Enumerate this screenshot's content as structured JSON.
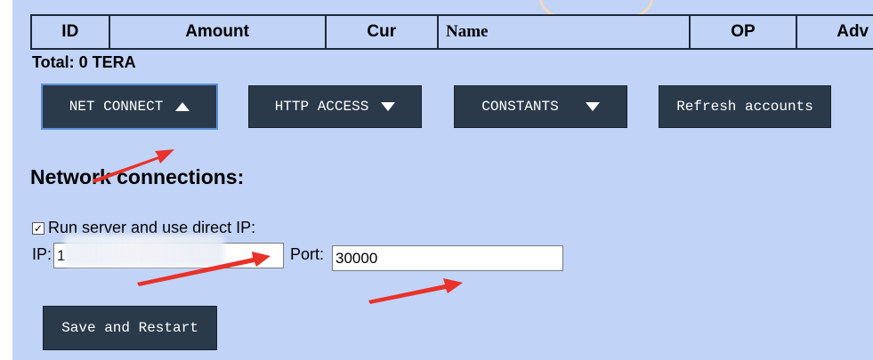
{
  "table_header": {
    "columns": [
      "ID",
      "Amount",
      "Cur",
      "Name",
      "OP",
      "Adv"
    ]
  },
  "total": "Total: 0 TERA",
  "buttons": {
    "net_connect": "NET CONNECT",
    "http_access": "HTTP ACCESS",
    "constants": "CONSTANTS",
    "refresh_accounts": "Refresh accounts",
    "save_restart": "Save and Restart"
  },
  "section_title": "Network connections:",
  "run_server": {
    "label": "Run server and use direct IP:",
    "checked": true
  },
  "ip": {
    "label": "IP:",
    "value": "1"
  },
  "port": {
    "label": "Port:",
    "value": "30000"
  },
  "colors": {
    "panel_bg": "#c1d3f7",
    "button_bg": "#2b3a4a",
    "arrow": "#e8322a"
  }
}
